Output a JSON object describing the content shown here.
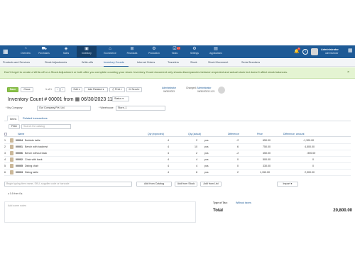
{
  "nav": {
    "items": [
      {
        "label": "Overview",
        "icon": "pie-chart-icon"
      },
      {
        "label": "Purchases",
        "icon": "cart-icon"
      },
      {
        "label": "Sales",
        "icon": "tag-icon"
      },
      {
        "label": "Inventory",
        "icon": "box-icon"
      },
      {
        "label": "Ecommerce",
        "icon": "shop-icon"
      },
      {
        "label": "Financials",
        "icon": "bank-icon"
      },
      {
        "label": "Production",
        "icon": "factory-icon"
      },
      {
        "label": "Tasks",
        "icon": "tasks-icon",
        "badge": "17"
      },
      {
        "label": "Settings",
        "icon": "gear-icon"
      },
      {
        "label": "Applications",
        "icon": "apps-icon"
      }
    ],
    "active": "Inventory"
  },
  "user": {
    "name": "Administrator",
    "role": "administrator",
    "notification_count": "1"
  },
  "subnav": {
    "items": [
      "Products and Services",
      "Stock Adjustments",
      "Write-offs",
      "Inventory Counts",
      "Internal Orders",
      "Transfers",
      "Stock",
      "Stock Movement",
      "Serial Numbers"
    ],
    "active": "Inventory Counts"
  },
  "alert": {
    "text": "Don't forget to create a Write-off or a Stock Adjustment or both after you complete counting your stock. Inventory Count document only shows discrepancies between expected and actual stock but doesn't affect stock balances.",
    "close": "×"
  },
  "toolbar": {
    "save": "Save",
    "close": "Close",
    "pager": "1 of 1",
    "edit": "Edit",
    "add_related": "Add Related",
    "print": "Print",
    "send": "Send",
    "created_by": "Administrator",
    "created_at": "06/30/2023",
    "changed_label": "Changed",
    "changed_by": "Administrator",
    "changed_at": "06/30/2023 11:21"
  },
  "document": {
    "title_prefix": "Inventory Count #",
    "number": "00001",
    "from_label": "from",
    "date": "06/30/2023 11:21",
    "status": "Status"
  },
  "fields": {
    "company_label": "My Company",
    "company_value": "Our Company Pvt. Ltd.",
    "warehouse_label": "Warehouse",
    "warehouse_value": "Store_1"
  },
  "tabs": [
    "Items",
    "Related transactions"
  ],
  "filter": {
    "button": "Filter",
    "placeholder": "Search the catalog"
  },
  "table": {
    "columns": [
      "Name",
      "Qty (expected)",
      "Qty (actual)",
      "Difference",
      "Price",
      "Difference, amount"
    ],
    "rows": [
      {
        "n": "1",
        "code": "00004",
        "name": "Bedside table",
        "exp": "4",
        "act": "2",
        "unit": "pcs",
        "diff": "-2",
        "price": "650.00",
        "amount": "-1,300.00"
      },
      {
        "n": "2",
        "code": "00001",
        "name": "Bench with backrest",
        "exp": "4",
        "act": "10",
        "unit": "pcs",
        "diff": "6",
        "price": "750.00",
        "amount": "4,500.00"
      },
      {
        "n": "3",
        "code": "00006",
        "name": "Bench without back",
        "exp": "4",
        "act": "2",
        "unit": "pcs",
        "diff": "-2",
        "price": "450.00",
        "amount": "-900.00"
      },
      {
        "n": "4",
        "code": "00002",
        "name": "Chair with back",
        "exp": "4",
        "act": "4",
        "unit": "pcs",
        "diff": "0",
        "price": "500.00",
        "amount": "0"
      },
      {
        "n": "5",
        "code": "00005",
        "name": "Dining chair",
        "exp": "4",
        "act": "4",
        "unit": "pcs",
        "diff": "0",
        "price": "330.00",
        "amount": "0"
      },
      {
        "n": "6",
        "code": "00003",
        "name": "Dining table",
        "exp": "4",
        "act": "6",
        "unit": "pcs",
        "diff": "2",
        "price": "1,150.00",
        "amount": "2,300.00"
      }
    ]
  },
  "add_row": {
    "placeholder": "Begin typing item name, SKU, supplier code or barcode",
    "add_from_catalog": "Add from Catalog",
    "add_from_stock": "Add from Stock",
    "add_from_list": "Add from List",
    "import": "Import",
    "pager": "1-6 from 6"
  },
  "notes": {
    "placeholder": "Add some notes"
  },
  "summary": {
    "type_label": "Type of Tax:",
    "type_value": "Without taxes",
    "total_label": "Total",
    "total_value": "20,800.00"
  },
  "colors": {
    "topbar": "#1e5a96",
    "accent": "#8bc34a",
    "alert_bg": "#e4f4d2"
  }
}
